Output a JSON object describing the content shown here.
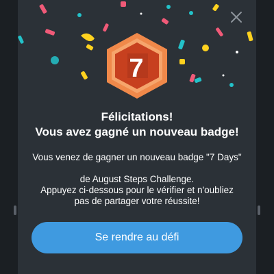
{
  "dialog": {
    "title_line1": "Félicitations!",
    "title_line2": "Vous avez gagné un nouveau badge!",
    "message_line1": "Vous venez de gagner un nouveau badge \"7 Days\"",
    "message_line2": "de August Steps Challenge.",
    "message_line3": "Appuyez ci-dessous pour le vérifier et n'oubliez",
    "message_line4": "pas de partager votre réussite!",
    "cta_label": "Se rendre au défi",
    "close_icon": "close-icon"
  },
  "badge": {
    "number": "7",
    "icon": "hexagon-badge-icon",
    "colors": {
      "outer": "#f0894a",
      "inner": "#c7401f",
      "ring": "#f6a56c"
    }
  },
  "colors": {
    "background": "#2b3137",
    "button": "#3f9ae0",
    "text": "#ffffff",
    "confetti": [
      "#f05a78",
      "#ffd21f",
      "#23c2c9",
      "#ffffff"
    ]
  }
}
